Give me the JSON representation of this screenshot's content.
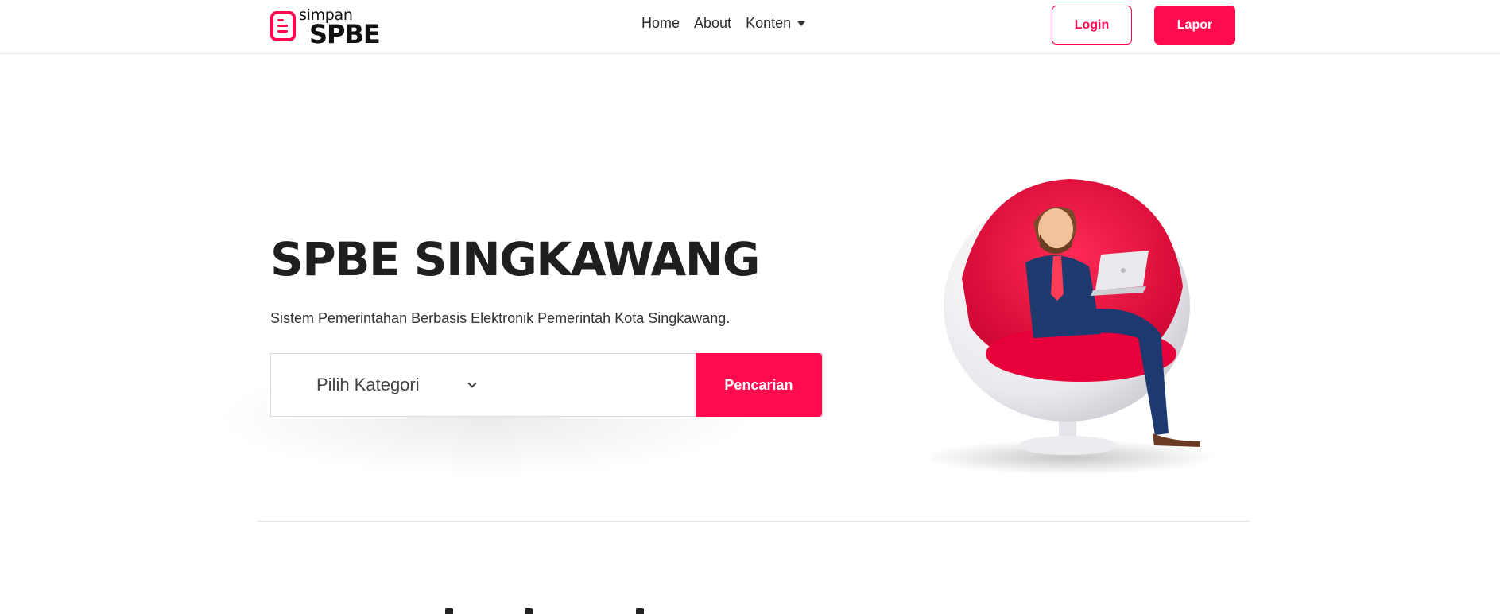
{
  "brand": {
    "logo_small": "simpan",
    "logo_big": "SPBE",
    "accent_color": "#ff0a4e"
  },
  "nav": {
    "items": [
      {
        "label": "Home"
      },
      {
        "label": "About"
      },
      {
        "label": "Konten",
        "has_dropdown": true
      }
    ],
    "login_label": "Login",
    "lapor_label": "Lapor"
  },
  "hero": {
    "title": "SPBE SINGKAWANG",
    "subtitle": "Sistem Pemerintahan Berbasis Elektronik Pemerintah Kota Singkawang.",
    "search": {
      "category_selected": "Pilih Kategori",
      "input_value": "",
      "input_placeholder": "",
      "button_label": "Pencarian"
    },
    "illustration": "man-in-egg-chair-with-laptop"
  }
}
